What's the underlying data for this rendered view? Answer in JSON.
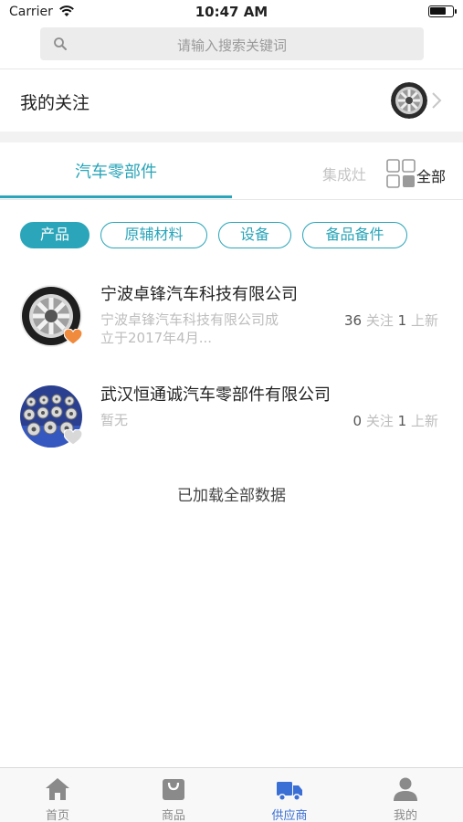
{
  "status_bar": {
    "carrier": "Carrier",
    "time": "10:47 AM",
    "battery_level": 0.75
  },
  "search": {
    "placeholder": "请输入搜索关键词",
    "icon": "search-icon"
  },
  "my_follow": {
    "title": "我的关注",
    "avatar_icon": "wheel-rim-icon",
    "chevron": "chevron-right-icon"
  },
  "category_tabs": {
    "active": "汽车零部件",
    "other": "集成灶",
    "all_label": "全部",
    "all_icon": "grid-icon",
    "accent_color": "#2aa5b9"
  },
  "chips": [
    {
      "label": "产品",
      "active": true
    },
    {
      "label": "原辅材料",
      "active": false
    },
    {
      "label": "设备",
      "active": false
    },
    {
      "label": "备品备件",
      "active": false
    }
  ],
  "companies": [
    {
      "name": "宁波卓锋汽车科技有限公司",
      "description_line1": "宁波卓锋汽车科技有限公司成",
      "description_line2": "立于2017年4月...",
      "followers": "36",
      "followers_label": "关注",
      "new_count": "1",
      "new_label": "上新",
      "followed": true,
      "heart_color": "#f08a3c"
    },
    {
      "name": "武汉恒通诚汽车零部件有限公司",
      "description_line1": "暂无",
      "description_line2": "",
      "followers": "0",
      "followers_label": "关注",
      "new_count": "1",
      "new_label": "上新",
      "followed": false,
      "heart_color": "#d8d8d8"
    }
  ],
  "loaded_message": "已加载全部数据",
  "tabbar": {
    "items": [
      {
        "label": "首页",
        "icon": "home-icon",
        "active": false
      },
      {
        "label": "商品",
        "icon": "shopping-bag-icon",
        "active": false
      },
      {
        "label": "供应商",
        "icon": "truck-icon",
        "active": true
      },
      {
        "label": "我的",
        "icon": "person-icon",
        "active": false
      }
    ],
    "active_color": "#3a6fd6",
    "inactive_color": "#8a8a8a"
  }
}
